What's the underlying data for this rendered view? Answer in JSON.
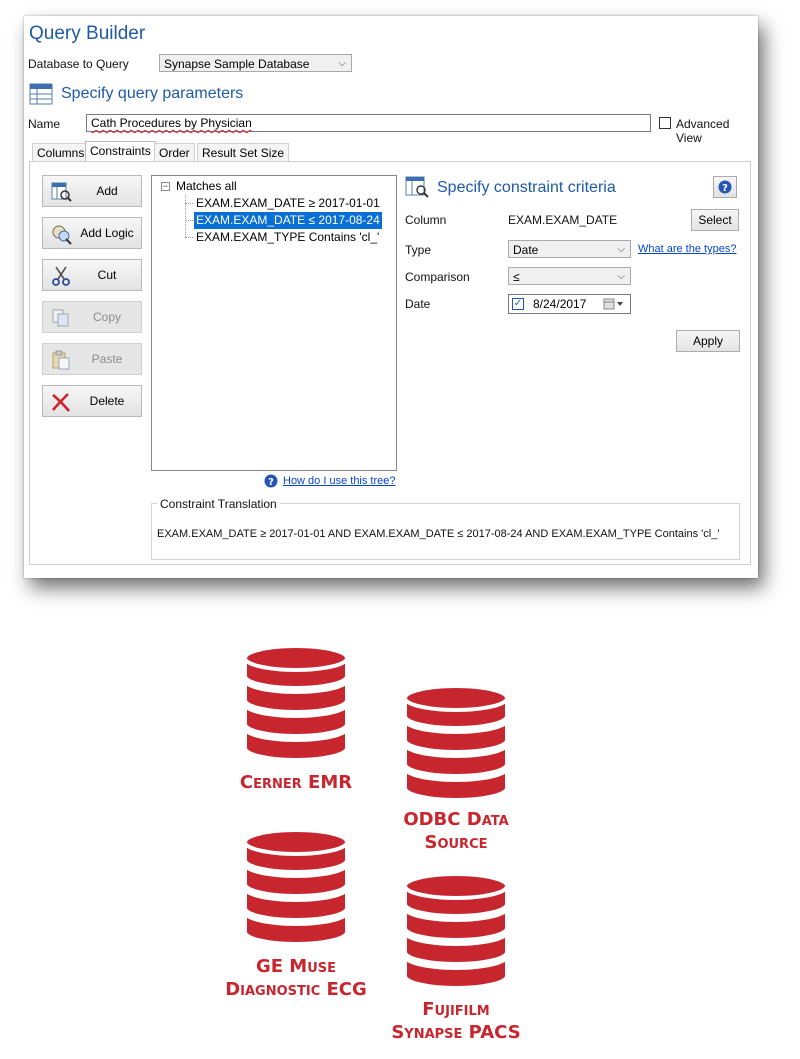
{
  "window": {
    "title": "Query Builder"
  },
  "database": {
    "label": "Database to Query",
    "value": "Synapse Sample Database"
  },
  "params": {
    "title": "Specify query parameters"
  },
  "name_field": {
    "label": "Name",
    "value": "Cath Procedures by Physician"
  },
  "advanced_view": {
    "label": "Advanced View",
    "checked": false
  },
  "tabs": [
    {
      "label": "Columns"
    },
    {
      "label": "Constraints",
      "active": true
    },
    {
      "label": "Order"
    },
    {
      "label": "Result Set Size"
    }
  ],
  "buttons": {
    "add": "Add",
    "add_logic": "Add Logic",
    "cut": "Cut",
    "copy": "Copy",
    "paste": "Paste",
    "delete": "Delete"
  },
  "tree": {
    "root": "Matches all",
    "children": [
      "EXAM.EXAM_DATE ≥ 2017-01-01",
      "EXAM.EXAM_DATE ≤ 2017-08-24",
      "EXAM.EXAM_TYPE Contains 'cl_'"
    ],
    "selected_index": 1,
    "help_link": "How do I use this tree?"
  },
  "criteria": {
    "title": "Specify constraint criteria",
    "column_label": "Column",
    "column_value": "EXAM.EXAM_DATE",
    "select_button": "Select",
    "type_label": "Type",
    "type_value": "Date",
    "types_link": "What are the types?",
    "comparison_label": "Comparison",
    "comparison_value": "≤",
    "date_label": "Date",
    "date_value": "8/24/2017",
    "apply_button": "Apply"
  },
  "translation": {
    "label": "Constraint Translation",
    "text": "EXAM.EXAM_DATE ≥ 2017-01-01 AND EXAM.EXAM_DATE ≤ 2017-08-24 AND EXAM.EXAM_TYPE Contains 'cl_'"
  },
  "data_sources": [
    {
      "line1": "Cerner EMR",
      "line2": ""
    },
    {
      "line1": "ODBC Data",
      "line2": "Source"
    },
    {
      "line1": "GE Muse",
      "line2": "Diagnostic ECG"
    },
    {
      "line1": "Fujifilm",
      "line2": "Synapse PACS"
    }
  ],
  "colors": {
    "accent_blue": "#1e5aa8",
    "selection": "#0a6fd4",
    "database_red": "#c8262e",
    "link": "#0645d1"
  }
}
